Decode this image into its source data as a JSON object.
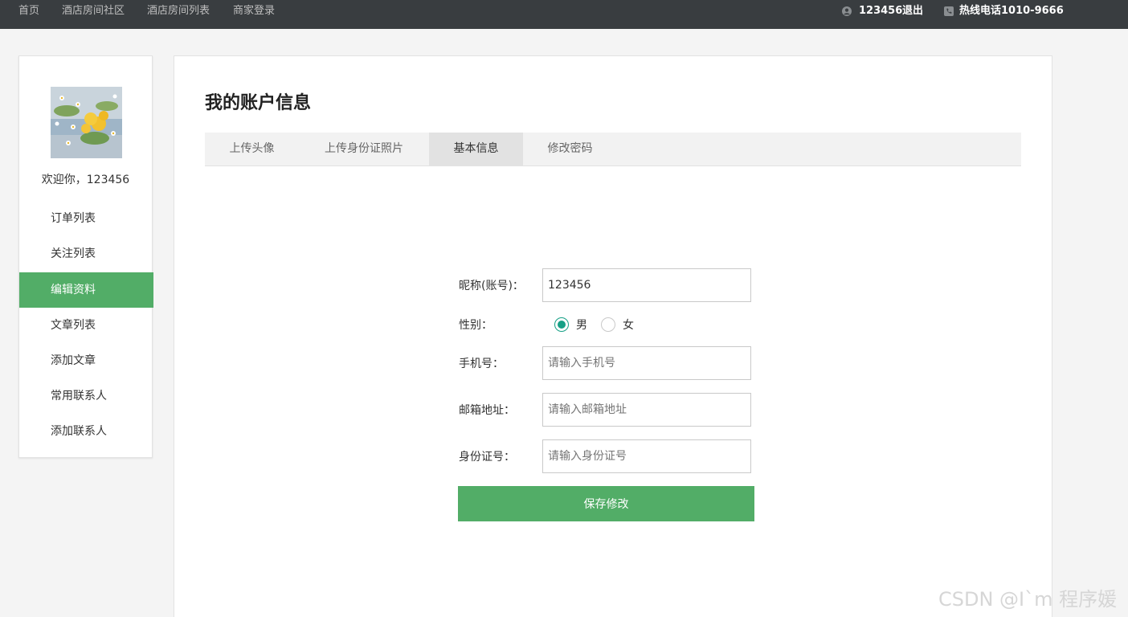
{
  "topbar": {
    "nav": [
      "首页",
      "酒店房间社区",
      "酒店房间列表",
      "商家登录"
    ],
    "username": "123456",
    "logout": "退出",
    "hotline": "热线电话1010-9666",
    "icons": {
      "user": "user-icon",
      "phone": "phone-icon"
    }
  },
  "sidebar": {
    "welcome": "欢迎你，123456",
    "items": [
      {
        "label": "订单列表"
      },
      {
        "label": "关注列表"
      },
      {
        "label": "编辑资料",
        "active": true
      },
      {
        "label": "文章列表"
      },
      {
        "label": "添加文章"
      },
      {
        "label": "常用联系人"
      },
      {
        "label": "添加联系人"
      }
    ]
  },
  "main": {
    "title": "我的账户信息",
    "tabs": [
      {
        "label": "上传头像"
      },
      {
        "label": "上传身份证照片"
      },
      {
        "label": "基本信息",
        "active": true
      },
      {
        "label": "修改密码"
      }
    ],
    "form": {
      "nickname_label": "昵称(账号)：",
      "nickname_value": "123456",
      "gender_label": "性别：",
      "gender_options": [
        "男",
        "女"
      ],
      "gender_selected": "男",
      "phone_label": "手机号：",
      "phone_placeholder": "请输入手机号",
      "email_label": "邮箱地址：",
      "email_placeholder": "请输入邮箱地址",
      "id_label": "身份证号：",
      "id_placeholder": "请输入身份证号",
      "save_label": "保存修改"
    }
  },
  "watermark": "CSDN @I`m 程序媛",
  "colors": {
    "accent": "#52ad67",
    "topbar": "#393d40",
    "radio": "#16a086"
  }
}
